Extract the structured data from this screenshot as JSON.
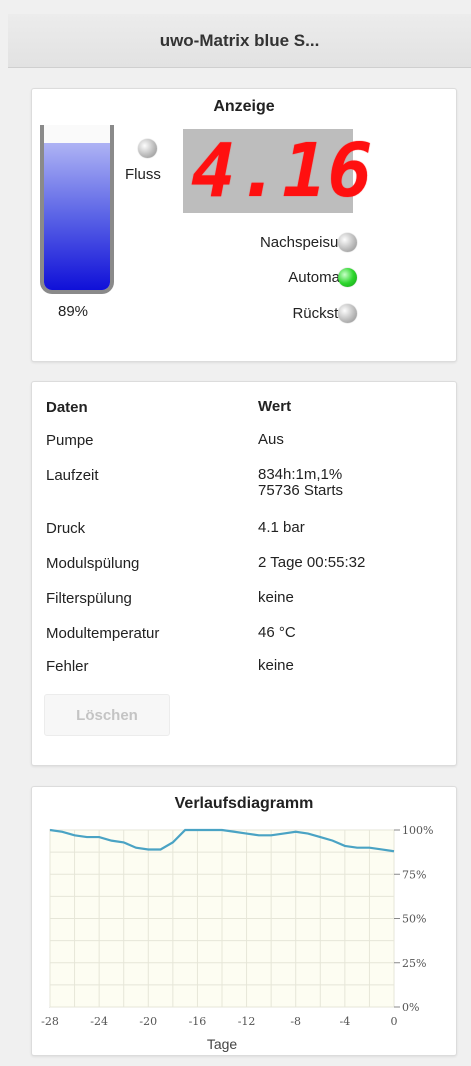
{
  "header": {
    "title": "uwo-Matrix blue S..."
  },
  "anzeige": {
    "title": "Anzeige",
    "tank_percent": 89,
    "tank_label": "89%",
    "fluss_label": "Fluss",
    "display_value": "4.16",
    "indicators": [
      {
        "label": "Nachspeisung",
        "state": "off"
      },
      {
        "label": "Automatik",
        "state": "on"
      },
      {
        "label": "Rückstau",
        "state": "off"
      }
    ],
    "colors": {
      "tank_fill": "#1010d8",
      "display_digits": "#ff1010",
      "led_on": "#2ed62e",
      "led_off": "#bcbcbc"
    }
  },
  "daten": {
    "header": {
      "key": "Daten",
      "value": "Wert"
    },
    "rows": [
      {
        "key": "Pumpe",
        "value": "Aus"
      },
      {
        "key": "Laufzeit",
        "value": "834h:1m,1%",
        "value2": "75736 Starts"
      },
      {
        "key": "Druck",
        "value": "4.1 bar"
      },
      {
        "key": "Modulspülung",
        "value": "2 Tage 00:55:32"
      },
      {
        "key": "Filterspülung",
        "value": "keine"
      },
      {
        "key": "Modultemperatur",
        "value": "46 °C"
      },
      {
        "key": "Fehler",
        "value": "keine"
      }
    ],
    "clear_button": "Löschen"
  },
  "chart": {
    "title": "Verlaufsdiagramm"
  },
  "chart_data": {
    "type": "line",
    "title": "Verlaufsdiagramm",
    "xlabel": "Tage",
    "ylabel": "",
    "xlim": [
      -28,
      0
    ],
    "ylim": [
      0,
      100
    ],
    "x_ticks": [
      "-28",
      "-24",
      "-20",
      "-16",
      "-12",
      "-8",
      "-4",
      "0"
    ],
    "y_ticks": [
      "0%",
      "25%",
      "50%",
      "75%",
      "100%"
    ],
    "y_tick_values": [
      0,
      25,
      50,
      75,
      100
    ],
    "x_tick_values": [
      -28,
      -24,
      -20,
      -16,
      -12,
      -8,
      -4,
      0
    ],
    "grid": true,
    "series": [
      {
        "color": "#4aa3c4",
        "x": [
          -28,
          -27,
          -26,
          -25,
          -24,
          -23,
          -22,
          -21,
          -20,
          -19,
          -18,
          -17,
          -16,
          -15,
          -14,
          -13,
          -12,
          -11,
          -10,
          -9,
          -8,
          -7,
          -6,
          -5,
          -4,
          -3,
          -2,
          -1,
          0
        ],
        "values": [
          100,
          99,
          97,
          96,
          96,
          94,
          93,
          90,
          89,
          89,
          93,
          100,
          100,
          100,
          100,
          99,
          98,
          97,
          97,
          98,
          99,
          98,
          96,
          94,
          91,
          90,
          90,
          89,
          88
        ]
      }
    ]
  }
}
